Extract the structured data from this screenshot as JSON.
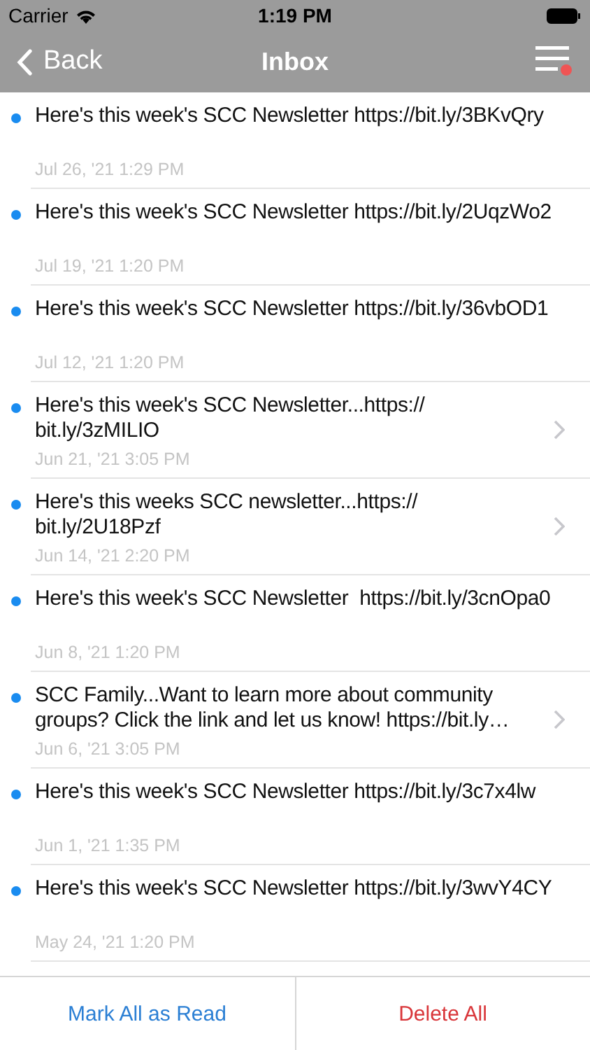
{
  "status_bar": {
    "carrier": "Carrier",
    "time": "1:19 PM"
  },
  "nav": {
    "back": "Back",
    "title": "Inbox",
    "menu_badge": true
  },
  "messages": [
    {
      "text": "Here's this week's SCC Newsletter https://bit.ly/3BKvQry",
      "date": "Jul 26, '21 1:29 PM",
      "unread": true,
      "chevron": false
    },
    {
      "text": "Here's this week's SCC Newsletter https://bit.ly/2UqzWo2",
      "date": "Jul 19, '21 1:20 PM",
      "unread": true,
      "chevron": false
    },
    {
      "text": "Here's this week's SCC Newsletter https://bit.ly/36vbOD1",
      "date": "Jul 12, '21 1:20 PM",
      "unread": true,
      "chevron": false
    },
    {
      "text": "Here's this week's SCC Newsletter...https://\nbit.ly/3zMILIO",
      "date": "Jun 21, '21 3:05 PM",
      "unread": true,
      "chevron": true
    },
    {
      "text": "Here's this weeks SCC newsletter...https://\nbit.ly/2U18Pzf",
      "date": "Jun 14, '21 2:20 PM",
      "unread": true,
      "chevron": true
    },
    {
      "text": "Here's this week's SCC Newsletter  https://bit.ly/3cnOpa0",
      "date": "Jun 8, '21 1:20 PM",
      "unread": true,
      "chevron": false
    },
    {
      "text": "SCC Family...Want to learn more about community groups? Click the link and let us know! https://bit.ly…",
      "date": "Jun 6, '21 3:05 PM",
      "unread": true,
      "chevron": true
    },
    {
      "text": "Here's this week's SCC Newsletter https://bit.ly/3c7x4lw",
      "date": "Jun 1, '21 1:35 PM",
      "unread": true,
      "chevron": false
    },
    {
      "text": "Here's this week's SCC Newsletter https://bit.ly/3wvY4CY",
      "date": "May 24, '21 1:20 PM",
      "unread": true,
      "chevron": false
    }
  ],
  "toolbar": {
    "mark_all": "Mark All as Read",
    "delete_all": "Delete All"
  }
}
